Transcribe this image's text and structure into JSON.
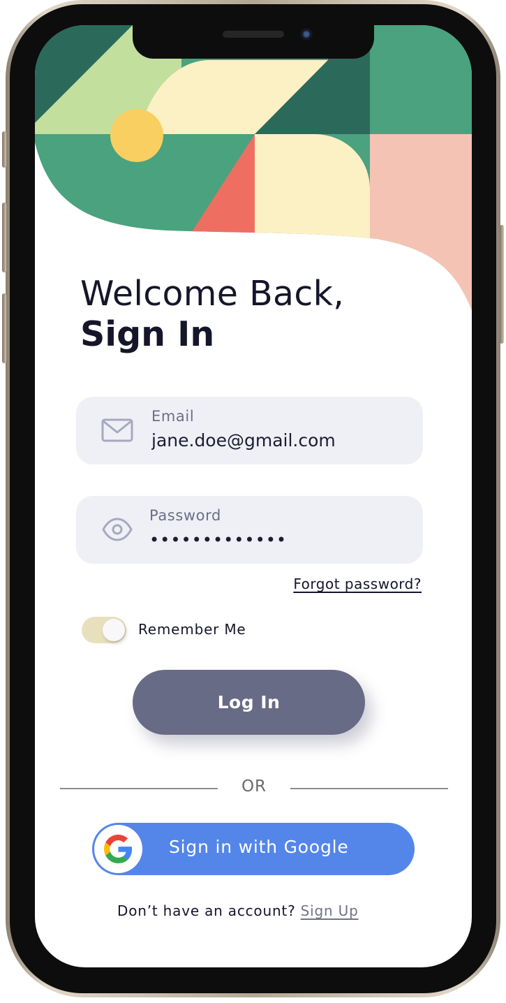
{
  "colors": {
    "dark_green": "#2b6a5b",
    "green": "#4aa27e",
    "light_green": "#c3df9d",
    "cream": "#fcf0c5",
    "yellow": "#f9cf61",
    "coral": "#ef6e62",
    "peach": "#f5c3b4",
    "field_bg": "#eff0f5",
    "login_button": "#686b86",
    "google_button": "#5486ea",
    "toggle_track": "#e8e0bd"
  },
  "header": {
    "welcome": "Welcome Back,",
    "title": "Sign In"
  },
  "email": {
    "icon": "mail-icon",
    "label": "Email",
    "value": "jane.doe@gmail.com"
  },
  "password": {
    "icon": "eye-icon",
    "label": "Password",
    "value": "•••••••••••••"
  },
  "forgot_password": "Forgot password?",
  "remember_me": {
    "label": "Remember Me",
    "enabled": true
  },
  "login_button": "Log In",
  "divider": "OR",
  "google_button": {
    "icon": "google-icon",
    "label": "Sign in with Google"
  },
  "footer": {
    "prompt": "Don’t have an account?",
    "link": "Sign Up"
  }
}
